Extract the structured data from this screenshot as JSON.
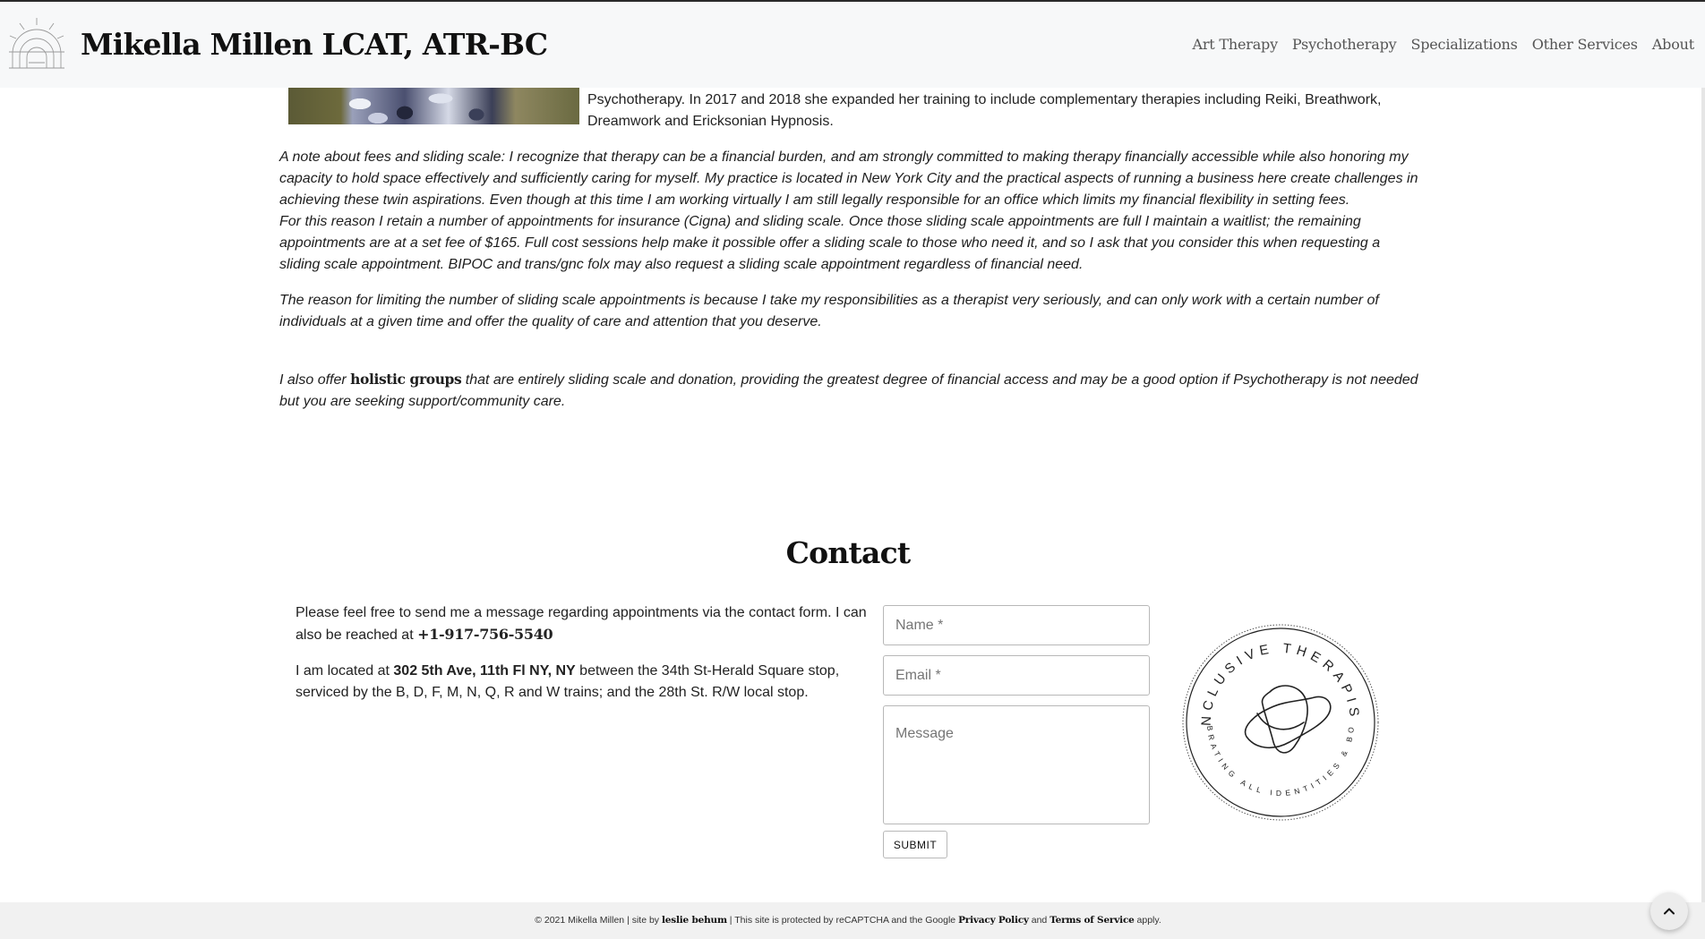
{
  "header": {
    "site_title": "Mikella Millen LCAT, ATR-BC",
    "nav": [
      "Art Therapy",
      "Psychotherapy",
      "Specializations",
      "Other Services",
      "About"
    ]
  },
  "bio": {
    "continuation": "Psychotherapy. In 2017 and 2018 she expanded her training to include complementary therapies including Reiki, Breathwork, Dreamwork and Ericksonian Hypnosis."
  },
  "fees": {
    "p1": "A note about fees and sliding scale: I recognize that therapy can be a financial burden, and am strongly committed to making therapy financially accessible while also honoring my capacity to hold space effectively and sufficiently caring for myself. My practice is located in New York City and the practical aspects of running a business here create challenges in achieving these twin aspirations. Even though at this time I am working virtually I am still legally responsible for an office which limits my financial flexibility in setting fees.",
    "p2": "For this reason I retain a number of appointments for insurance (Cigna) and sliding scale. Once those sliding scale appointments are full I maintain a waitlist; the remaining appointments are at a set fee of $165. Full cost sessions help make it possible offer a sliding scale to those who need it, and so I ask that you consider this when requesting a sliding scale appointment. BIPOC and trans/gnc folx may also request a sliding scale appointment regardless of financial need.",
    "p3": "The reason for limiting the number of sliding scale appointments is because I take my responsibilities as a therapist very seriously, and can only work with a certain number of individuals at a given time and offer the quality of care and attention that you deserve.",
    "groups_prefix": "I also offer ",
    "groups_link": "holistic groups",
    "groups_suffix": " that are entirely sliding scale and donation, providing the greatest degree of financial access and may be a good option if Psychotherapy is not needed but you are seeking support/community care."
  },
  "contact": {
    "title": "Contact",
    "intro": "Please feel free to send me a message regarding appointments via the contact form. I can also be reached at ",
    "phone": "+1-917-756-5540",
    "location_prefix": "I am located at ",
    "address": "302 5th Ave, 11th Fl NY, NY",
    "location_suffix": " between the 34th St-Herald Square stop, serviced by the B, D, F, M, N, Q, R and W trains; and the 28th St. R/W local stop.",
    "form": {
      "name_placeholder": "Name *",
      "email_placeholder": "Email *",
      "message_placeholder": "Message",
      "submit_label": "SUBMIT"
    },
    "badge": {
      "top_text": "INCLUSIVE THERAPIST",
      "bottom_text": "CELEBRATING ALL IDENTITIES & BODIES"
    }
  },
  "footer": {
    "prefix": "© 2021 Mikella Millen | site by ",
    "author": "leslie behum",
    "middle": " | This site is protected by reCAPTCHA and the Google ",
    "privacy": "Privacy Policy",
    "and": " and ",
    "terms": "Terms of Service",
    "suffix": " apply."
  },
  "icons": {
    "logo": "sunrise-arch-logo-icon",
    "back_to_top": "chevron-up-icon",
    "badge": "inclusive-therapist-badge"
  }
}
